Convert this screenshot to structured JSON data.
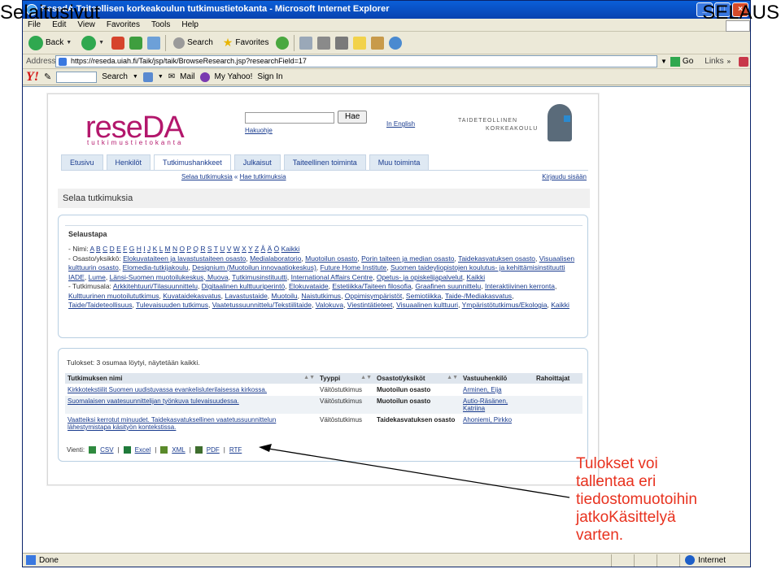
{
  "slide": {
    "title_left": "Selaitusivut",
    "title_right": "SELAUS"
  },
  "window": {
    "title": "ResedA Taiteellisen korkeakoulun tutkimustietokanta - Microsoft Internet Explorer",
    "menu": [
      "File",
      "Edit",
      "View",
      "Favorites",
      "Tools",
      "Help"
    ],
    "toolbar": {
      "back": "Back",
      "search": "Search",
      "favorites": "Favorites"
    },
    "address_label": "Address",
    "address_url": "https://reseda.uiah.fi/Taik/jsp/taik/BrowseResearch.jsp?researchField=17",
    "go_label": "Go",
    "links_label": "Links",
    "yahoo": {
      "logo": "Y!",
      "search": "Search",
      "mail": "Mail",
      "my_yahoo": "My Yahoo!",
      "sign_in": "Sign In"
    },
    "status": {
      "text": "Done",
      "zone": "Internet"
    }
  },
  "page": {
    "logo": "reseDA",
    "logo_sub": "tutkimustietokanta",
    "search_button": "Hae",
    "search_help": "Hakuohje",
    "english_link": "In English",
    "taik_logo_line1": "TAIDETEOLLINEN",
    "taik_logo_line2": "KORKEAKOULU",
    "tabs": [
      "Etusivu",
      "Henkilöt",
      "Tutkimushankkeet",
      "Julkaisut",
      "Taiteellinen toiminta",
      "Muu toiminta"
    ],
    "active_tab": "Tutkimushankkeet",
    "subnav": {
      "browse": "Selaa tutkimuksia",
      "sep": " « ",
      "search": "Hae tutkimuksia"
    },
    "login": "Kirjaudu sisään",
    "title": "Selaa tutkimuksia",
    "browse": {
      "heading": "Selaustapa",
      "name_label": "Nimi:",
      "letters": [
        "A",
        "B",
        "C",
        "D",
        "E",
        "F",
        "G",
        "H",
        "I",
        "J",
        "K",
        "L",
        "M",
        "N",
        "O",
        "P",
        "Q",
        "R",
        "S",
        "T",
        "U",
        "V",
        "W",
        "X",
        "Y",
        "Z",
        "Å",
        "Ä",
        "Ö",
        "Kaikki"
      ],
      "dept_label": "Osasto/yksikkö:",
      "departments": [
        "Elokuvataiteen ja lavastustaiteen osasto",
        "Medialaboratorio",
        "Muotoilun osasto",
        "Porin taiteen ja median osasto",
        "Taidekasvatuksen osasto",
        "Visuaalisen kulttuurin osasto",
        "Elomedia-tutkijakoulu",
        "Designium (Muotoilun innovaatiokeskus)",
        "Future Home Institute",
        "Suomen taideyliopistojen koulutus- ja kehittämisinstituutti IADE",
        "Lume",
        "Länsi-Suomen muotoilukeskus, Muova",
        "Tutkimusinstituutti",
        "International Affairs Centre",
        "Opetus- ja opiskelijapalvelut",
        "Kaikki"
      ],
      "field_label": "Tutkimusala:",
      "fields": [
        "Arkkitehtuuri/Tilasuunnittelu",
        "Digitaalinen kulttuuriperintö",
        "Elokuvataide",
        "Estetiikka/Taiteen filosofia",
        "Graafinen suunnittelu",
        "Interaktiivinen kerronta",
        "Kulttuurinen muotoilututkimus",
        "Kuvataidekasvatus",
        "Lavastustaide",
        "Muotoilu",
        "Naistutkimus",
        "Oppimisympäristöt",
        "Semiotiikka",
        "Taide-/Mediakasvatus",
        "Taide/Taideteollisuus",
        "Tulevaisuuden tutkimus",
        "Vaatetussuunnittelu/Tekstiilitaide",
        "Valokuva",
        "Viestintätieteet",
        "Visuaalinen kulttuuri",
        "Ympäristötutkimus/Ekologia",
        "Kaikki"
      ]
    },
    "results": {
      "summary": "Tulokset: 3 osumaa löytyi, näytetään kaikki.",
      "columns": [
        "Tutkimuksen nimi",
        "Tyyppi",
        "Osastot/yksiköt",
        "Vastuuhenkilö",
        "Rahoittajat"
      ],
      "rows": [
        {
          "name": "Kirkkotekstiilit Suomen uudistuvassa evankelisluterilaisessa kirkossa.",
          "type": "Väitöstutkimus",
          "dept": "Muotoilun osasto",
          "person": "Arminen, Eija",
          "funder": ""
        },
        {
          "name": "Suomalaisen vaatesuunnittelijan työnkuva tulevaisuudessa.",
          "type": "Väitöstutkimus",
          "dept": "Muotoilun osasto",
          "person": "Autio-Räsänen, Katriina",
          "funder": ""
        },
        {
          "name": "Vaatteiksi kerrotut minuudet. Taidekasvatuksellinen vaatetussuunnittelun lähestymistapa käsityön kontekstissa.",
          "type": "Väitöstutkimus",
          "dept": "Taidekasvatuksen osasto",
          "person": "Ahoniemi, Pirkko",
          "funder": ""
        }
      ],
      "export_label": "Vienti:",
      "export_formats": [
        "CSV",
        "Excel",
        "XML",
        "PDF",
        "RTF"
      ]
    }
  },
  "annotation": {
    "lines": [
      "Tulokset voi",
      "tallentaa eri",
      "tiedostomuotoihin",
      "jatkoKäsittelyä",
      "varten."
    ],
    "color": "#e8321f"
  }
}
